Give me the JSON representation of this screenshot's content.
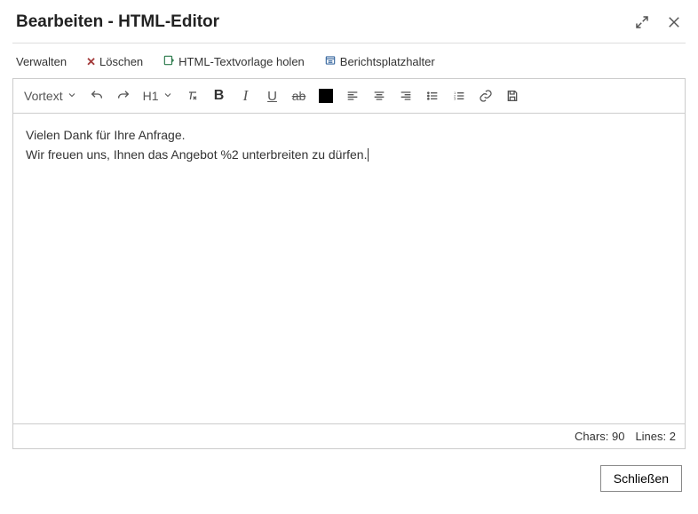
{
  "title": "Bearbeiten - HTML-Editor",
  "menu": {
    "manage": "Verwalten",
    "delete": "Löschen",
    "fetch_template": "HTML-Textvorlage holen",
    "report_placeholder": "Berichtsplatzhalter"
  },
  "toolbar": {
    "preset_label": "Vortext",
    "heading_label": "H1"
  },
  "editor": {
    "line1": "Vielen Dank für Ihre Anfrage.",
    "line2": "Wir freuen uns, Ihnen das Angebot %2 unterbreiten zu dürfen."
  },
  "status": {
    "chars_label": "Chars:",
    "chars_value": "90",
    "lines_label": "Lines:",
    "lines_value": "2"
  },
  "footer": {
    "close": "Schließen"
  }
}
